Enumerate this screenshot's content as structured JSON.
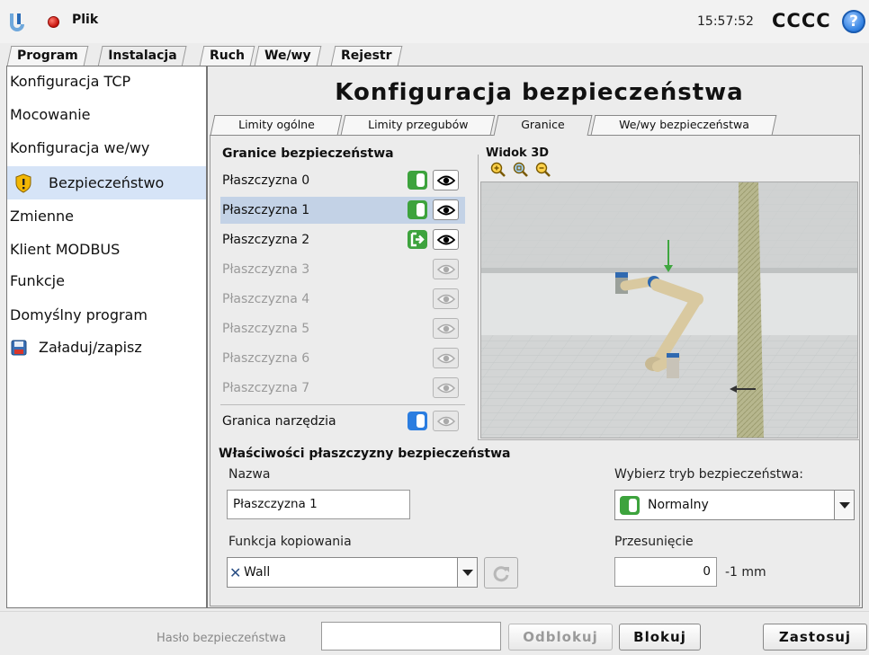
{
  "topbar": {
    "file_menu": "Plik",
    "clock": "15:57:52",
    "robot_name": "CCCC",
    "help_label": "?"
  },
  "main_tabs": [
    {
      "label": "Program"
    },
    {
      "label": "Instalacja"
    },
    {
      "label": "Ruch"
    },
    {
      "label": "We/wy"
    },
    {
      "label": "Rejestr"
    }
  ],
  "sidebar": {
    "items": [
      {
        "label": "Konfiguracja TCP"
      },
      {
        "label": "Mocowanie"
      },
      {
        "label": "Konfiguracja we/wy"
      },
      {
        "label": "Bezpieczeństwo"
      },
      {
        "label": "Zmienne"
      },
      {
        "label": "Klient MODBUS"
      },
      {
        "label": "Funkcje"
      },
      {
        "label": "Domyślny program"
      },
      {
        "label": "Załaduj/zapisz"
      }
    ]
  },
  "page": {
    "title": "Konfiguracja bezpieczeństwa",
    "sub_tabs": [
      {
        "label": "Limity ogólne"
      },
      {
        "label": "Limity przegubów"
      },
      {
        "label": "Granice"
      },
      {
        "label": "We/wy bezpieczeństwa"
      }
    ]
  },
  "boundaries": {
    "title": "Granice bezpieczeństwa",
    "planes": [
      {
        "label": "Płaszczyzna 0",
        "mode": "normal"
      },
      {
        "label": "Płaszczyzna 1",
        "mode": "normal"
      },
      {
        "label": "Płaszczyzna 2",
        "mode": "reduced"
      },
      {
        "label": "Płaszczyzna 3",
        "mode": "disabled"
      },
      {
        "label": "Płaszczyzna 4",
        "mode": "disabled"
      },
      {
        "label": "Płaszczyzna 5",
        "mode": "disabled"
      },
      {
        "label": "Płaszczyzna 6",
        "mode": "disabled"
      },
      {
        "label": "Płaszczyzna 7",
        "mode": "disabled"
      }
    ],
    "tool_boundary_label": "Granica narzędzia"
  },
  "view3d": {
    "title": "Widok 3D"
  },
  "properties": {
    "title": "Właściwości płaszczyzny bezpieczeństwa",
    "name_label": "Nazwa",
    "name_value": "Płaszczyzna 1",
    "copy_label": "Funkcja kopiowania",
    "copy_value": "Wall",
    "mode_label": "Wybierz tryb bezpieczeństwa:",
    "mode_value": "Normalny",
    "offset_label": "Przesunięcie",
    "offset_value": "0",
    "offset_unit": "-1 mm"
  },
  "bottombar": {
    "password_label": "Hasło bezpieczeństwa",
    "password_value": "",
    "unlock_label": "Odblokuj",
    "lock_label": "Blokuj",
    "apply_label": "Zastosuj"
  },
  "colors": {
    "normal_toggle": "#3da33d",
    "tool_toggle": "#2b7de0",
    "selected_row": "#c3d2e6",
    "status_dot": "#c4110a"
  }
}
